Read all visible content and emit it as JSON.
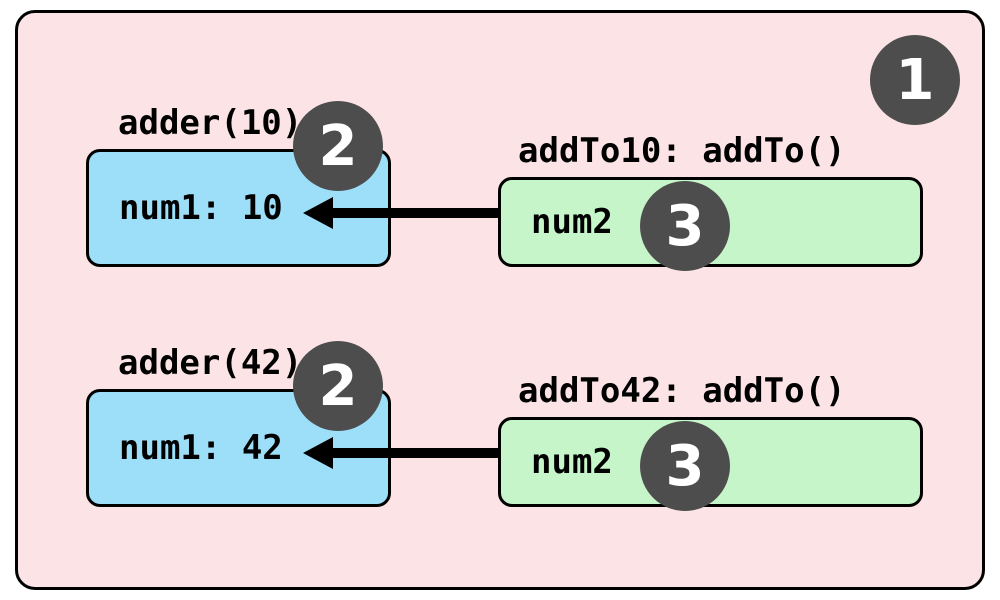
{
  "badges": {
    "outer": "1",
    "adder": "2",
    "addto": "3"
  },
  "rows": [
    {
      "adder_label": "adder(10)",
      "adder_content": "num1: 10",
      "addto_label": "addTo10: addTo()",
      "addto_content": "num2"
    },
    {
      "adder_label": "adder(42)",
      "adder_content": "num1: 42",
      "addto_label": "addTo42: addTo()",
      "addto_content": "num2"
    }
  ]
}
